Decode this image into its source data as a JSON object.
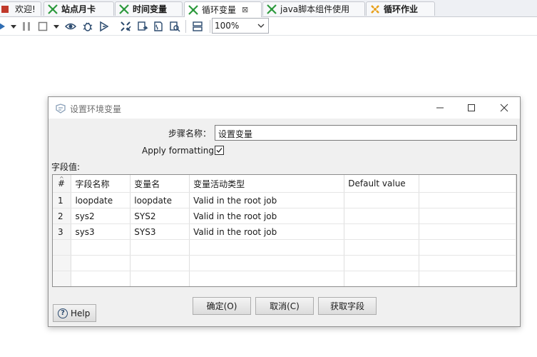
{
  "tabs": [
    {
      "label": "欢迎!",
      "icon": "welcome-icon",
      "bold": false,
      "closable": false
    },
    {
      "label": "站点月卡",
      "icon": "transformation-icon",
      "bold": true,
      "closable": false
    },
    {
      "label": "时间变量",
      "icon": "transformation-icon",
      "bold": true,
      "closable": false
    },
    {
      "label": "循环变量",
      "icon": "transformation-icon",
      "bold": false,
      "closable": true,
      "active": true
    },
    {
      "label": "java脚本组件使用",
      "icon": "transformation-icon",
      "bold": false,
      "closable": false
    },
    {
      "label": "循环作业",
      "icon": "job-icon",
      "bold": true,
      "closable": false
    }
  ],
  "toolbar": {
    "zoom_value": "100%"
  },
  "dialog": {
    "title": "设置环境变量",
    "step_name_label": "步骤名称：",
    "step_name_value": "设置变量",
    "apply_formatting_label": "Apply formatting",
    "apply_formatting_checked": true,
    "fields_label": "字段值:",
    "table": {
      "columns": [
        "#",
        "字段名称",
        "变量名",
        "变量活动类型",
        "Default value"
      ],
      "rows": [
        [
          "1",
          "loopdate",
          "loopdate",
          "Valid in the root job",
          ""
        ],
        [
          "2",
          "sys2",
          "SYS2",
          "Valid in the root job",
          ""
        ],
        [
          "3",
          "sys3",
          "SYS3",
          "Valid in the root job",
          ""
        ]
      ]
    },
    "buttons": {
      "ok": "确定(O)",
      "cancel": "取消(C)",
      "get_fields": "获取字段",
      "help": "Help"
    }
  },
  "colors": {
    "accent_green": "#2e9a3e",
    "job_orange": "#e8a01c",
    "help_blue": "#2b4a6e"
  }
}
